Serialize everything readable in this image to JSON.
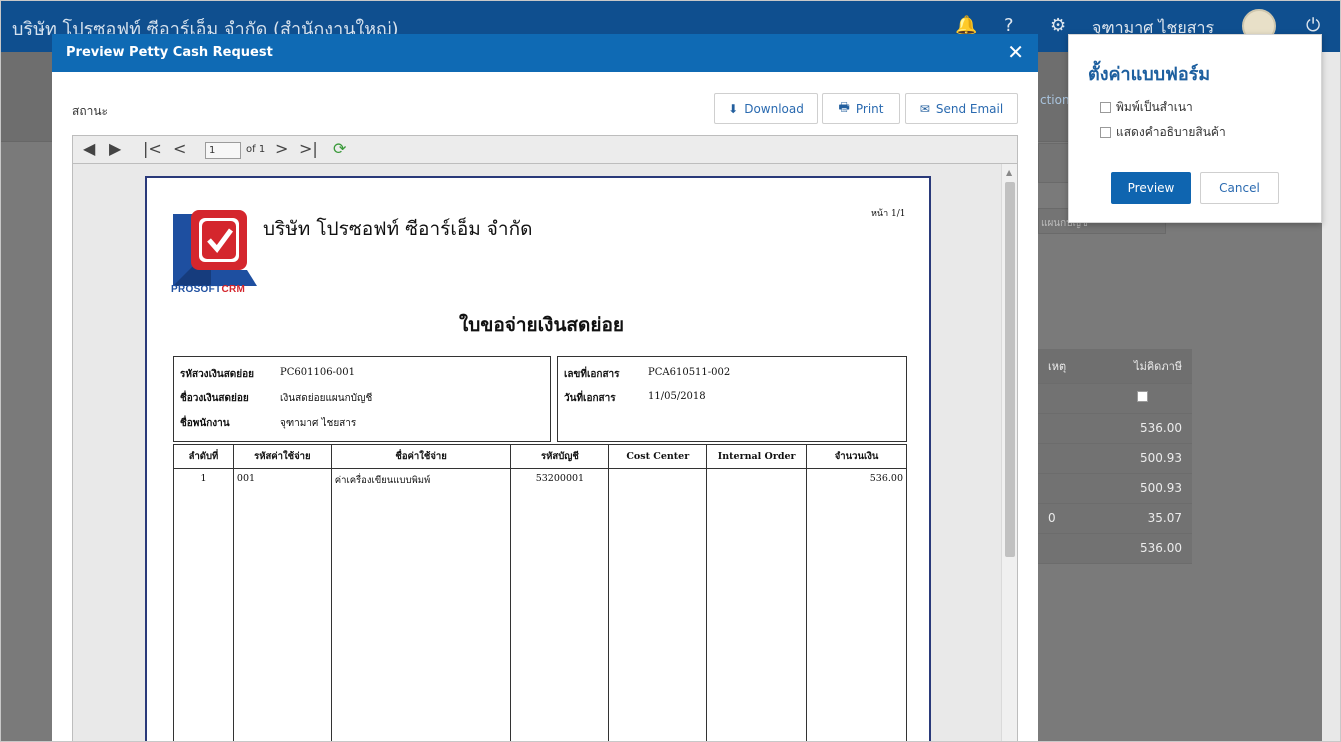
{
  "app": {
    "title": "บริษัท โปรซอฟท์ ซีอาร์เอ็ม จำกัด (สำนักงานใหญ่)",
    "user_name": "จุฑามาศ ไชยสาร"
  },
  "background": {
    "action_label": "ction",
    "field_label": "แผนกบัญชี",
    "table": {
      "headers": [
        "เหตุ",
        "ไม่คิดภาษี"
      ],
      "values": [
        "536.00",
        "500.93",
        "500.93",
        "35.07",
        "536.00"
      ],
      "partial_zero": "0"
    }
  },
  "modal": {
    "title": "Preview Petty Cash Request",
    "status_label": "สถานะ",
    "buttons": {
      "download": "Download",
      "print": "Print",
      "send_email": "Send Email"
    },
    "viewer": {
      "current_page": "1",
      "of_label": "of 1"
    }
  },
  "document": {
    "company_name": "บริษัท โปรซอฟท์ ซีอาร์เอ็ม จำกัด",
    "logo_text_a": "PROSOFT",
    "logo_text_b": "CRM",
    "page_label": "หน้า 1/1",
    "title": "ใบขอจ่ายเงินสดย่อย",
    "left_info": [
      {
        "label": "รหัสวงเงินสดย่อย",
        "value": "PC601106-001"
      },
      {
        "label": "ชื่อวงเงินสดย่อย",
        "value": "เงินสดย่อยแผนกบัญชี"
      },
      {
        "label": "ชื่อพนักงาน",
        "value": "จุฑามาศ ไชยสาร"
      }
    ],
    "right_info": [
      {
        "label": "เลขที่เอกสาร",
        "value": "PCA610511-002"
      },
      {
        "label": "วันที่เอกสาร",
        "value": "11/05/2018"
      }
    ],
    "table": {
      "headers": [
        "ลำดับที่",
        "รหัสค่าใช้จ่าย",
        "ชื่อค่าใช้จ่าย",
        "รหัสบัญชี",
        "Cost Center",
        "Internal Order",
        "จำนวนเงิน"
      ],
      "rows": [
        [
          "1",
          "001",
          "ค่าเครื่องเขียนแบบพิมพ์",
          "53200001",
          "",
          "",
          "536.00"
        ]
      ]
    }
  },
  "form_settings": {
    "title": "ตั้งค่าแบบฟอร์ม",
    "options": [
      "พิมพ์เป็นสำเนา",
      "แสดงคำอธิบายสินค้า"
    ],
    "preview_label": "Preview",
    "cancel_label": "Cancel"
  },
  "colors": {
    "header_blue": "#0f4f8f",
    "modal_header": "#0f6ab4",
    "primary_button": "#0f65b0",
    "logo_red": "#d4262d",
    "logo_blue": "#1e4fa0"
  }
}
